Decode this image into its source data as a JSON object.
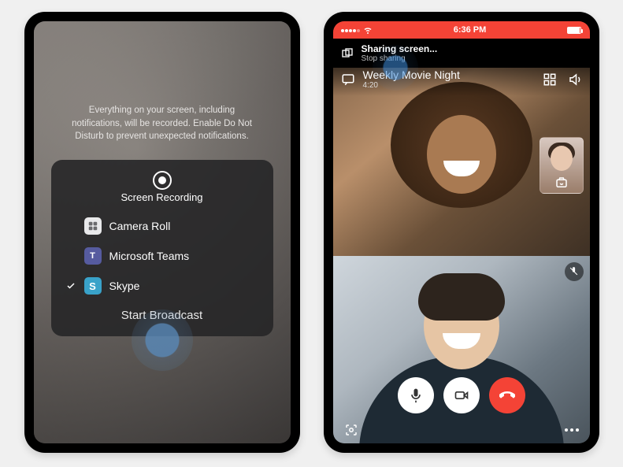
{
  "left": {
    "info": "Everything on your screen, including notifications, will be recorded. Enable Do Not Disturb to prevent unexpected notifications.",
    "sheet_title": "Screen Recording",
    "apps": [
      {
        "label": "Camera Roll",
        "selected": false
      },
      {
        "label": "Microsoft Teams",
        "selected": false
      },
      {
        "label": "Skype",
        "selected": true
      }
    ],
    "start_label": "Start Broadcast"
  },
  "right": {
    "status_time": "6:36 PM",
    "banner_title": "Sharing screen...",
    "banner_subtitle": "Stop sharing",
    "call_title": "Weekly Movie Night",
    "call_duration": "4:20"
  }
}
